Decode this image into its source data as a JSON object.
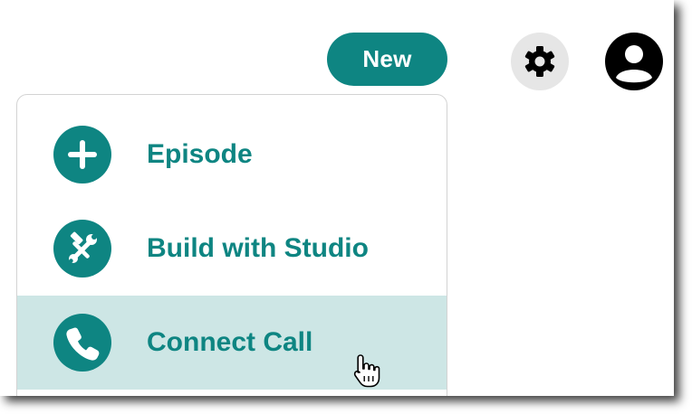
{
  "header": {
    "new_label": "New"
  },
  "menu": {
    "items": [
      {
        "label": "Episode",
        "icon": "plus-icon",
        "state": "default"
      },
      {
        "label": "Build with Studio",
        "icon": "tools-icon",
        "state": "default"
      },
      {
        "label": "Connect Call",
        "icon": "phone-icon",
        "state": "hovered"
      }
    ]
  },
  "colors": {
    "accent": "#0e8582",
    "hover_bg": "#cde6e5",
    "gear_bg": "#e6e6e6",
    "menu_border": "#d3d3d3"
  },
  "icons": {
    "settings": "gear-icon",
    "account": "user-avatar-icon",
    "pointer": "hand-cursor-icon"
  }
}
